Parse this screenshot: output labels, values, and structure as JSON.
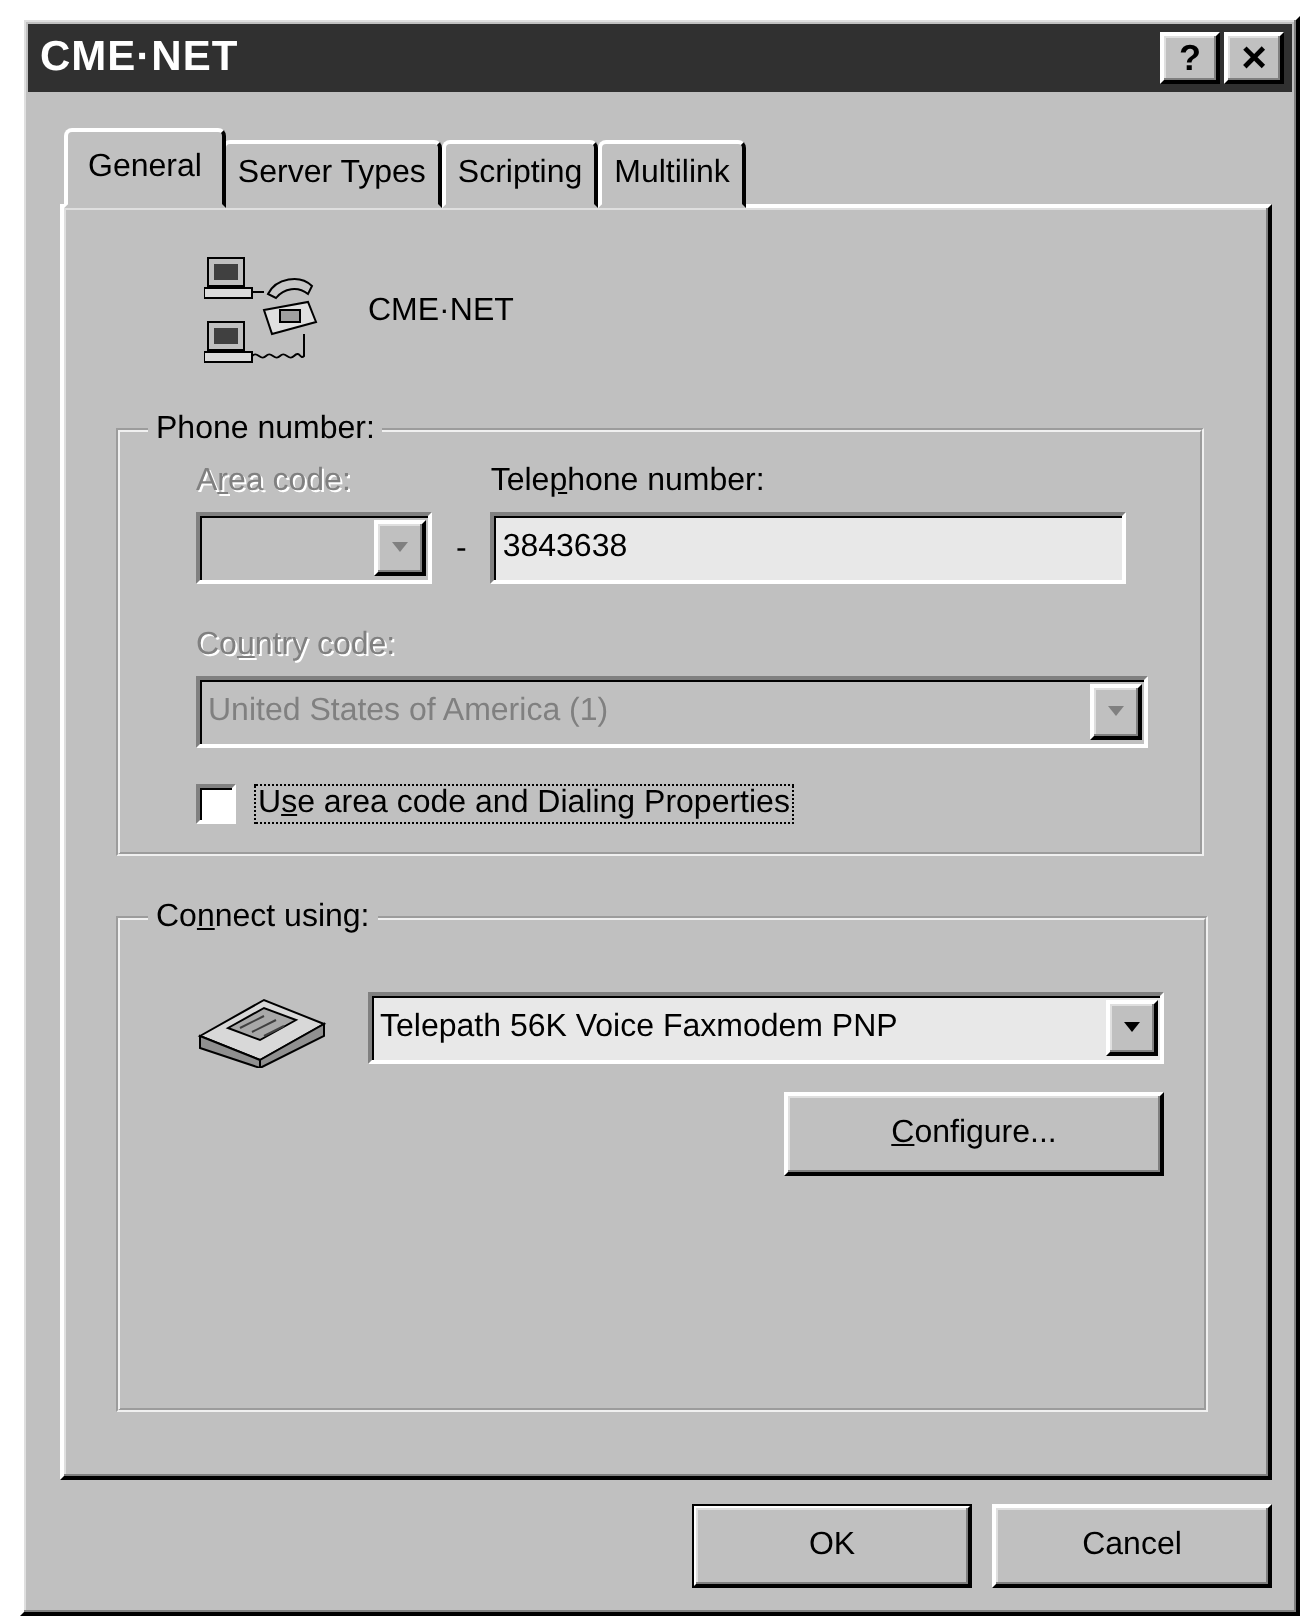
{
  "window": {
    "title": "CME·NET",
    "buttons": [
      {
        "kind": "help",
        "label": "?"
      },
      {
        "kind": "close",
        "label": "×"
      }
    ]
  },
  "tabs": [
    {
      "label": "General",
      "selected": true
    },
    {
      "label": "Server Types",
      "selected": false
    },
    {
      "label": "Scripting",
      "selected": false
    },
    {
      "label": "Multilink",
      "selected": false
    }
  ],
  "connection": {
    "name": "CME·NET"
  },
  "phone_group": {
    "title": "Phone number:",
    "area_code": {
      "label": [
        "A",
        "r",
        "ea code:"
      ],
      "disabled": true
    },
    "separator": "-",
    "telephone": {
      "label": [
        "Tele",
        "p",
        "hone number:"
      ],
      "value": "3843638",
      "disabled": false
    },
    "country_code": {
      "label": [
        "Co",
        "u",
        "ntry code:"
      ],
      "value": "United States of America (1)",
      "disabled": true
    },
    "use_area_code": {
      "label": [
        "U",
        "s",
        "e area code and Dialing Properties"
      ],
      "checked": false,
      "focused": true
    }
  },
  "connect_group": {
    "title": [
      "Co",
      "n",
      "nect using:"
    ],
    "device": {
      "value": "Telepath 56K Voice Faxmodem PNP",
      "disabled": false
    },
    "configure": {
      "label": {
        "key": "C",
        "after": "onfigure..."
      }
    }
  },
  "buttons": [
    {
      "label": "OK",
      "default": true
    },
    {
      "label": "Cancel",
      "default": false
    }
  ]
}
